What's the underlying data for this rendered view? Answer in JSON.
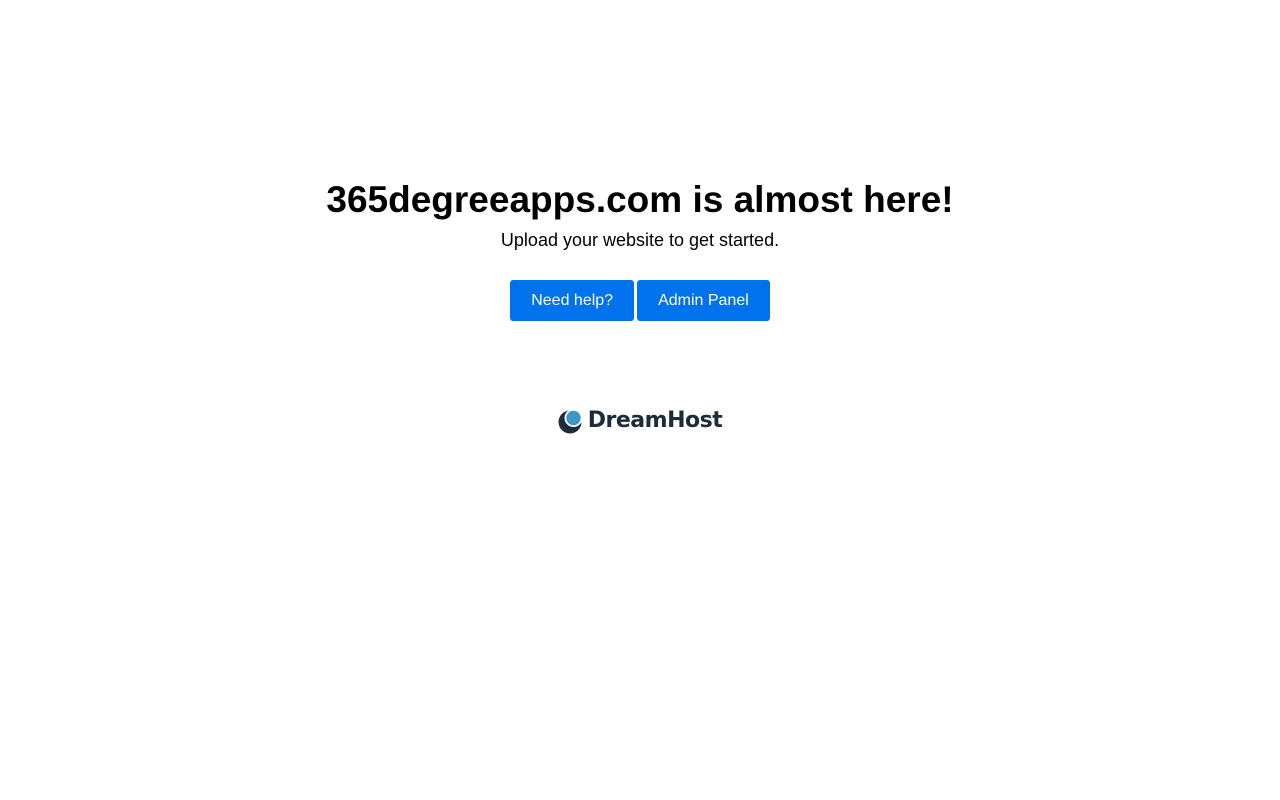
{
  "main": {
    "headline": "365degreeapps.com is almost here!",
    "subtitle": "Upload your website to get started."
  },
  "actions": {
    "help_label": "Need help?",
    "admin_label": "Admin Panel"
  },
  "footer": {
    "logo_text": "DreamHost",
    "logo_icon": "dreamhost-moon-icon"
  },
  "colors": {
    "button_bg": "#0073ec",
    "button_text": "#ffffff",
    "logo_dark": "#1d2b3a",
    "logo_blue": "#3b97c9"
  }
}
